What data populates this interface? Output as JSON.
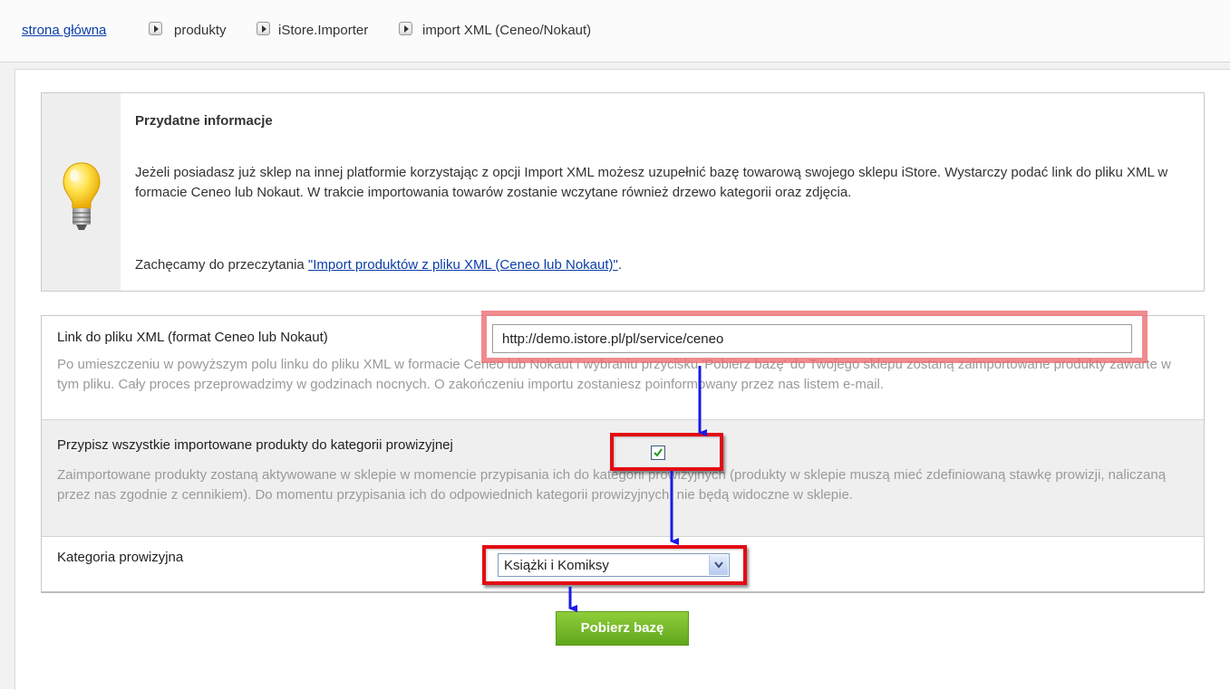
{
  "breadcrumb": {
    "items": [
      {
        "label": "strona główna",
        "link": true
      },
      {
        "label": "produkty",
        "link": false
      },
      {
        "label": "iStore.Importer",
        "link": false
      },
      {
        "label": "import XML (Ceneo/Nokaut)",
        "link": false
      }
    ],
    "separator_icon": "triangle-right-icon"
  },
  "info": {
    "icon": "lightbulb-icon",
    "title": "Przydatne informacje",
    "paragraph": "Jeżeli posiadasz już sklep na innej platformie korzystając z opcji Import XML możesz uzupełnić bazę towarową swojego sklepu iStore. Wystarczy podać link do pliku XML w formacie Ceneo lub Nokaut. W trakcie importowania towarów zostanie wczytane również drzewo kategorii oraz zdjęcia.",
    "invite_prefix": "Zachęcamy do przeczytania ",
    "invite_link": "\"Import produktów z pliku XML (Ceneo lub Nokaut)\"",
    "invite_suffix": "."
  },
  "form": {
    "xml_link": {
      "label": "Link do pliku XML (format Ceneo lub Nokaut)",
      "value": "http://demo.istore.pl/pl/service/ceneo",
      "help": "Po umieszczeniu w powyższym polu linku do pliku XML w formacie Ceneo lub Nokaut i wybraniu przycisku 'Pobierz bazę' do Twojego sklepu zostaną zaimportowane produkty zawarte w tym pliku. Cały proces przeprowadzimy w godzinach nocnych. O zakończeniu importu zostaniesz poinformowany przez nas listem e-mail."
    },
    "assign_category": {
      "label": "Przypisz wszystkie importowane produkty do kategorii prowizyjnej",
      "checked": true,
      "help": "Zaimportowane produkty zostaną aktywowane w sklepie w momencie przypisania ich do kategorii prowizyjnych (produkty w sklepie muszą mieć zdefiniowaną stawkę prowizji, naliczaną przez nas zgodnie z cennikiem). Do momentu przypisania ich do odpowiednich kategorii prowizyjnych, nie będą widoczne w sklepie."
    },
    "commission_category": {
      "label": "Kategoria prowizyjna",
      "selected": "Książki i Komiksy"
    },
    "submit_label": "Pobierz bazę"
  },
  "colors": {
    "link": "#0b3ea8",
    "highlight_red": "#e30b14",
    "highlight_pink": "#ec6a70",
    "arrow_blue": "#1a1ae6",
    "button_green": "#6fb72a"
  }
}
